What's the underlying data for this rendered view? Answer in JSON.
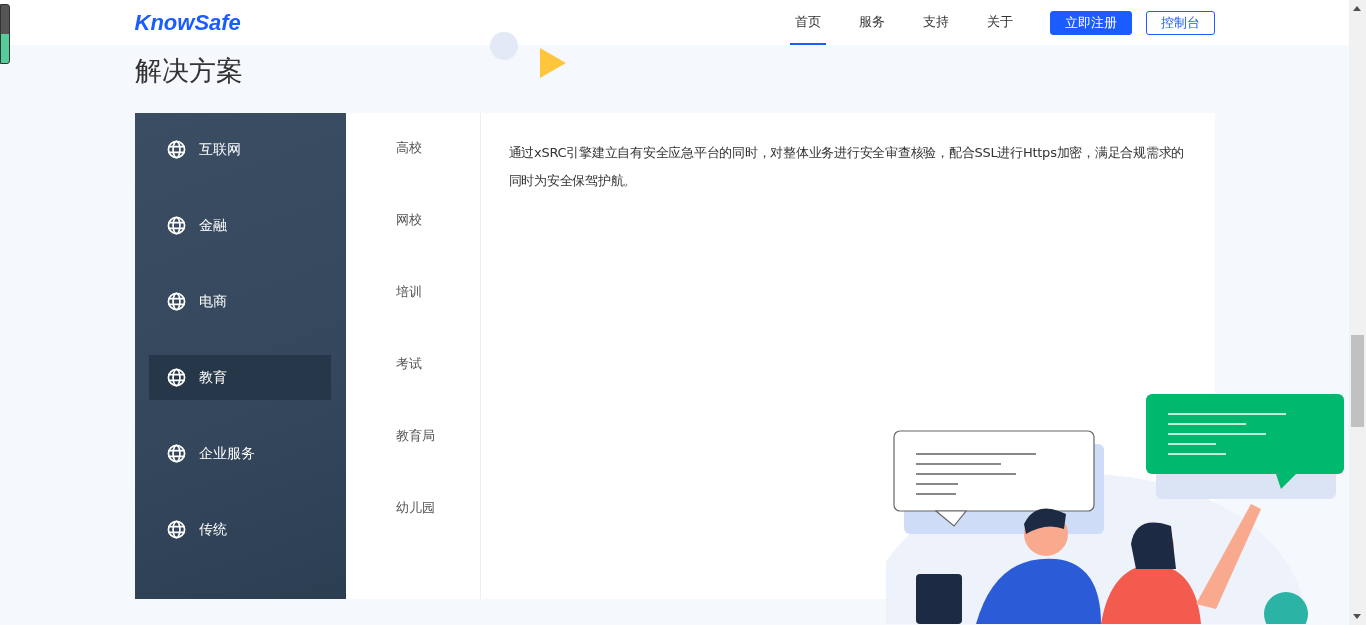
{
  "header": {
    "logo": "KnowSafe",
    "nav": [
      {
        "label": "首页",
        "selected": true
      },
      {
        "label": "服务",
        "selected": false
      },
      {
        "label": "支持",
        "selected": false
      },
      {
        "label": "关于",
        "selected": false
      }
    ],
    "register_button": "立即注册",
    "console_button": "控制台"
  },
  "section": {
    "title": "解决方案"
  },
  "industries": [
    {
      "label": "互联网",
      "selected": false
    },
    {
      "label": "金融",
      "selected": false
    },
    {
      "label": "电商",
      "selected": false
    },
    {
      "label": "教育",
      "selected": true
    },
    {
      "label": "企业服务",
      "selected": false
    },
    {
      "label": "传统",
      "selected": false
    }
  ],
  "sub_items": [
    "高校",
    "网校",
    "培训",
    "考试",
    "教育局",
    "幼儿园"
  ],
  "description": "通过xSRC引擎建立自有安全应急平台的同时，对整体业务进行安全审查核验，配合SSL进行Https加密，满足合规需求的同时为安全保驾护航。"
}
